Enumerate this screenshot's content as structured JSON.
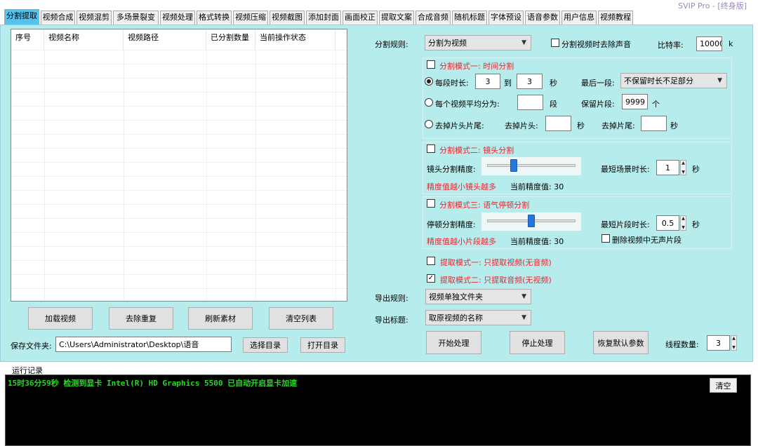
{
  "title_badge": "SVIP Pro - [终身版]",
  "tabs": [
    "分割提取",
    "视频合成",
    "视频混剪",
    "多场景裂变",
    "视频处理",
    "格式转换",
    "视频压缩",
    "视频截图",
    "添加封面",
    "画面校正",
    "提取文案",
    "合成音频",
    "随机标题",
    "字体预设",
    "语音参数",
    "用户信息",
    "视频教程"
  ],
  "active_tab": "分割提取",
  "list": {
    "columns": [
      "序号",
      "视频名称",
      "视频路径",
      "已分割数量",
      "当前操作状态"
    ]
  },
  "list_buttons": {
    "load": "加载视频",
    "dedupe": "去除重复",
    "refresh": "刷新素材",
    "clear": "清空列表"
  },
  "save": {
    "label": "保存文件夹:",
    "path": "C:\\Users\\Administrator\\Desktop\\语音",
    "choose": "选择目录",
    "open": "打开目录"
  },
  "split_rule": {
    "label": "分割规则:",
    "value": "分割为视频",
    "remove_audio_label": "分割视频时去除声音",
    "bitrate_label": "比特率:",
    "bitrate_value": "10000",
    "bitrate_unit": "k"
  },
  "mode1": {
    "title": "分割模式一: 时间分割",
    "each_label": "每段时长:",
    "from": "3",
    "to_label": "到",
    "to": "3",
    "sec": "秒",
    "last_label": "最后一段:",
    "last_value": "不保留时长不足部分",
    "avg_label": "每个视频平均分为:",
    "avg_value": "",
    "seg_unit": "段",
    "keep_label": "保留片段:",
    "keep_value": "9999",
    "keep_unit": "个",
    "trim_label": "去掉片头片尾:",
    "head_label": "去掉片头:",
    "head_value": "",
    "head_unit": "秒",
    "tail_label": "去掉片尾:",
    "tail_value": "",
    "tail_unit": "秒"
  },
  "mode2": {
    "title": "分割模式二: 镜头分割",
    "precision_label": "镜头分割精度:",
    "slider_fraction": 0.3,
    "min_scene_label": "最短场景时长:",
    "min_scene_value": "1",
    "min_scene_unit": "秒",
    "hint": "精度值越小镜头越多",
    "current_label": "当前精度值: 30"
  },
  "mode3": {
    "title": "分割模式三: 语气停顿分割",
    "precision_label": "停顿分割精度:",
    "slider_fraction": 0.5,
    "min_seg_label": "最短片段时长:",
    "min_seg_value": "0.5",
    "min_seg_unit": "秒",
    "hint": "精度值越小片段越多",
    "current_label": "当前精度值: 30",
    "remove_silence_label": "删除视频中无声片段"
  },
  "extract": {
    "mode1": "提取模式一: 只提取视频(无音频)",
    "mode2": "提取模式二: 只提取音频(无视频)"
  },
  "export": {
    "rule_label": "导出规则:",
    "rule_value": "视频单独文件夹",
    "title_label": "导出标题:",
    "title_value": "取原视频的名称"
  },
  "actions": {
    "start": "开始处理",
    "stop": "停止处理",
    "restore": "恢复默认参数",
    "threads_label": "线程数量:",
    "threads_value": "3"
  },
  "log": {
    "label": "运行记录",
    "text": "15时36分59秒 检测到显卡 Intel(R) HD Graphics 5500 已自动开启显卡加速",
    "clear": "清空"
  },
  "colors": {
    "panel": "#b7ecec",
    "active_tab": "#56c2ee",
    "red_label": "#e8262e",
    "log_text": "#22dd22"
  }
}
